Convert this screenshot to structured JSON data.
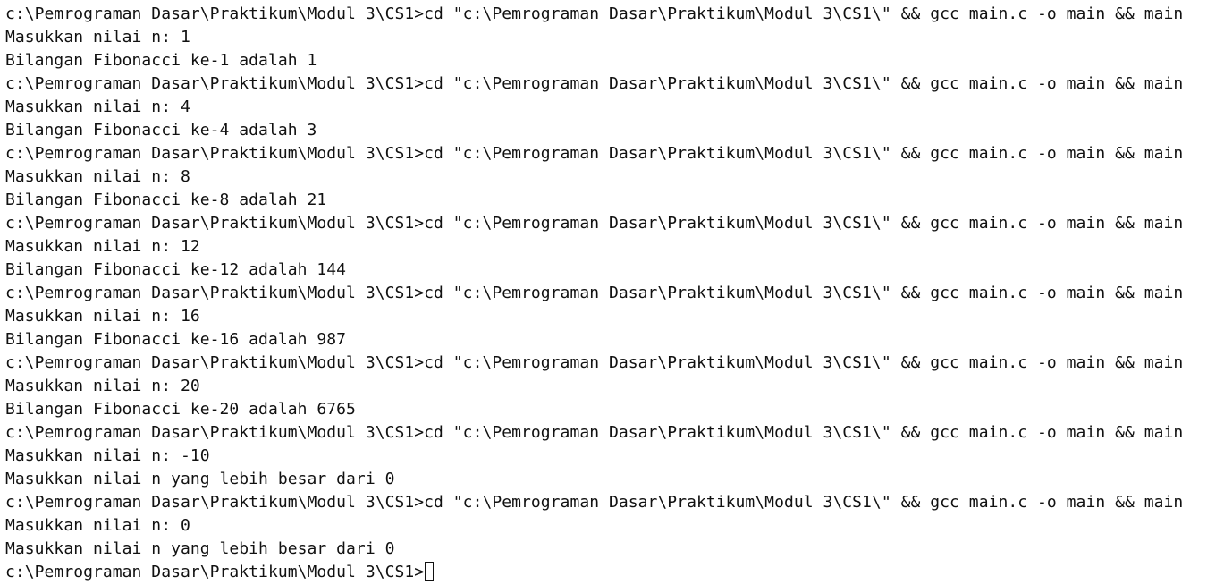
{
  "terminal": {
    "lines": [
      "c:\\Pemrograman Dasar\\Praktikum\\Modul 3\\CS1>cd \"c:\\Pemrograman Dasar\\Praktikum\\Modul 3\\CS1\\\" && gcc main.c -o main && main",
      "Masukkan nilai n: 1",
      "Bilangan Fibonacci ke-1 adalah 1",
      "c:\\Pemrograman Dasar\\Praktikum\\Modul 3\\CS1>cd \"c:\\Pemrograman Dasar\\Praktikum\\Modul 3\\CS1\\\" && gcc main.c -o main && main",
      "Masukkan nilai n: 4",
      "Bilangan Fibonacci ke-4 adalah 3",
      "c:\\Pemrograman Dasar\\Praktikum\\Modul 3\\CS1>cd \"c:\\Pemrograman Dasar\\Praktikum\\Modul 3\\CS1\\\" && gcc main.c -o main && main",
      "Masukkan nilai n: 8",
      "Bilangan Fibonacci ke-8 adalah 21",
      "c:\\Pemrograman Dasar\\Praktikum\\Modul 3\\CS1>cd \"c:\\Pemrograman Dasar\\Praktikum\\Modul 3\\CS1\\\" && gcc main.c -o main && main",
      "Masukkan nilai n: 12",
      "Bilangan Fibonacci ke-12 adalah 144",
      "c:\\Pemrograman Dasar\\Praktikum\\Modul 3\\CS1>cd \"c:\\Pemrograman Dasar\\Praktikum\\Modul 3\\CS1\\\" && gcc main.c -o main && main",
      "Masukkan nilai n: 16",
      "Bilangan Fibonacci ke-16 adalah 987",
      "c:\\Pemrograman Dasar\\Praktikum\\Modul 3\\CS1>cd \"c:\\Pemrograman Dasar\\Praktikum\\Modul 3\\CS1\\\" && gcc main.c -o main && main",
      "Masukkan nilai n: 20",
      "Bilangan Fibonacci ke-20 adalah 6765",
      "c:\\Pemrograman Dasar\\Praktikum\\Modul 3\\CS1>cd \"c:\\Pemrograman Dasar\\Praktikum\\Modul 3\\CS1\\\" && gcc main.c -o main && main",
      "Masukkan nilai n: -10",
      "Masukkan nilai n yang lebih besar dari 0",
      "c:\\Pemrograman Dasar\\Praktikum\\Modul 3\\CS1>cd \"c:\\Pemrograman Dasar\\Praktikum\\Modul 3\\CS1\\\" && gcc main.c -o main && main",
      "Masukkan nilai n: 0",
      "Masukkan nilai n yang lebih besar dari 0"
    ],
    "prompt": "c:\\Pemrograman Dasar\\Praktikum\\Modul 3\\CS1>",
    "cursor_icon": "block-cursor-icon"
  },
  "colors": {
    "background": "#ffffff",
    "text": "#111111"
  }
}
